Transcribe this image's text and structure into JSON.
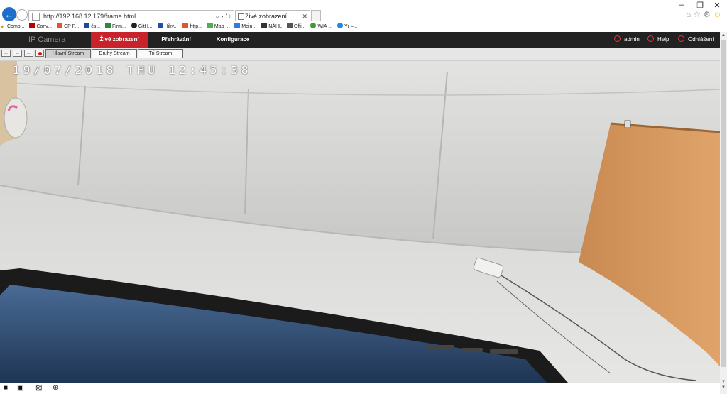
{
  "browser": {
    "url": "http://192.168.12.179/frame.html",
    "address_tools": "⌕ ▾ ↻",
    "tab_title": "Živé zobrazení",
    "window_controls": [
      "–",
      "❐",
      "✕"
    ],
    "favorites": [
      "Comp...",
      "Conv...",
      "CP P...",
      "čs...",
      "Firm...",
      "GitH...",
      "Hikv...",
      "http...",
      "Map ...",
      "Mein...",
      "NÁHL",
      "Offi...",
      "WIA ...",
      "Yr –..."
    ]
  },
  "app": {
    "brand": "IP Camera",
    "menu": [
      "Živé zobrazení",
      "Přehrávání",
      "Konfigurace"
    ],
    "user": "admin",
    "help": "Help",
    "logout": "Odhlášení"
  },
  "toolbar": {
    "streams": [
      "Hlavní Stream",
      "Druhý Stream",
      "Tri-Stream"
    ],
    "active_stream": "Hlavní Stream"
  },
  "video": {
    "osd_timestamp": "19/07/2018 THU 12:45:38"
  },
  "colors": {
    "accent": "#c8232a",
    "header_bg": "#222222",
    "ie_blue": "#1e6fc9"
  }
}
